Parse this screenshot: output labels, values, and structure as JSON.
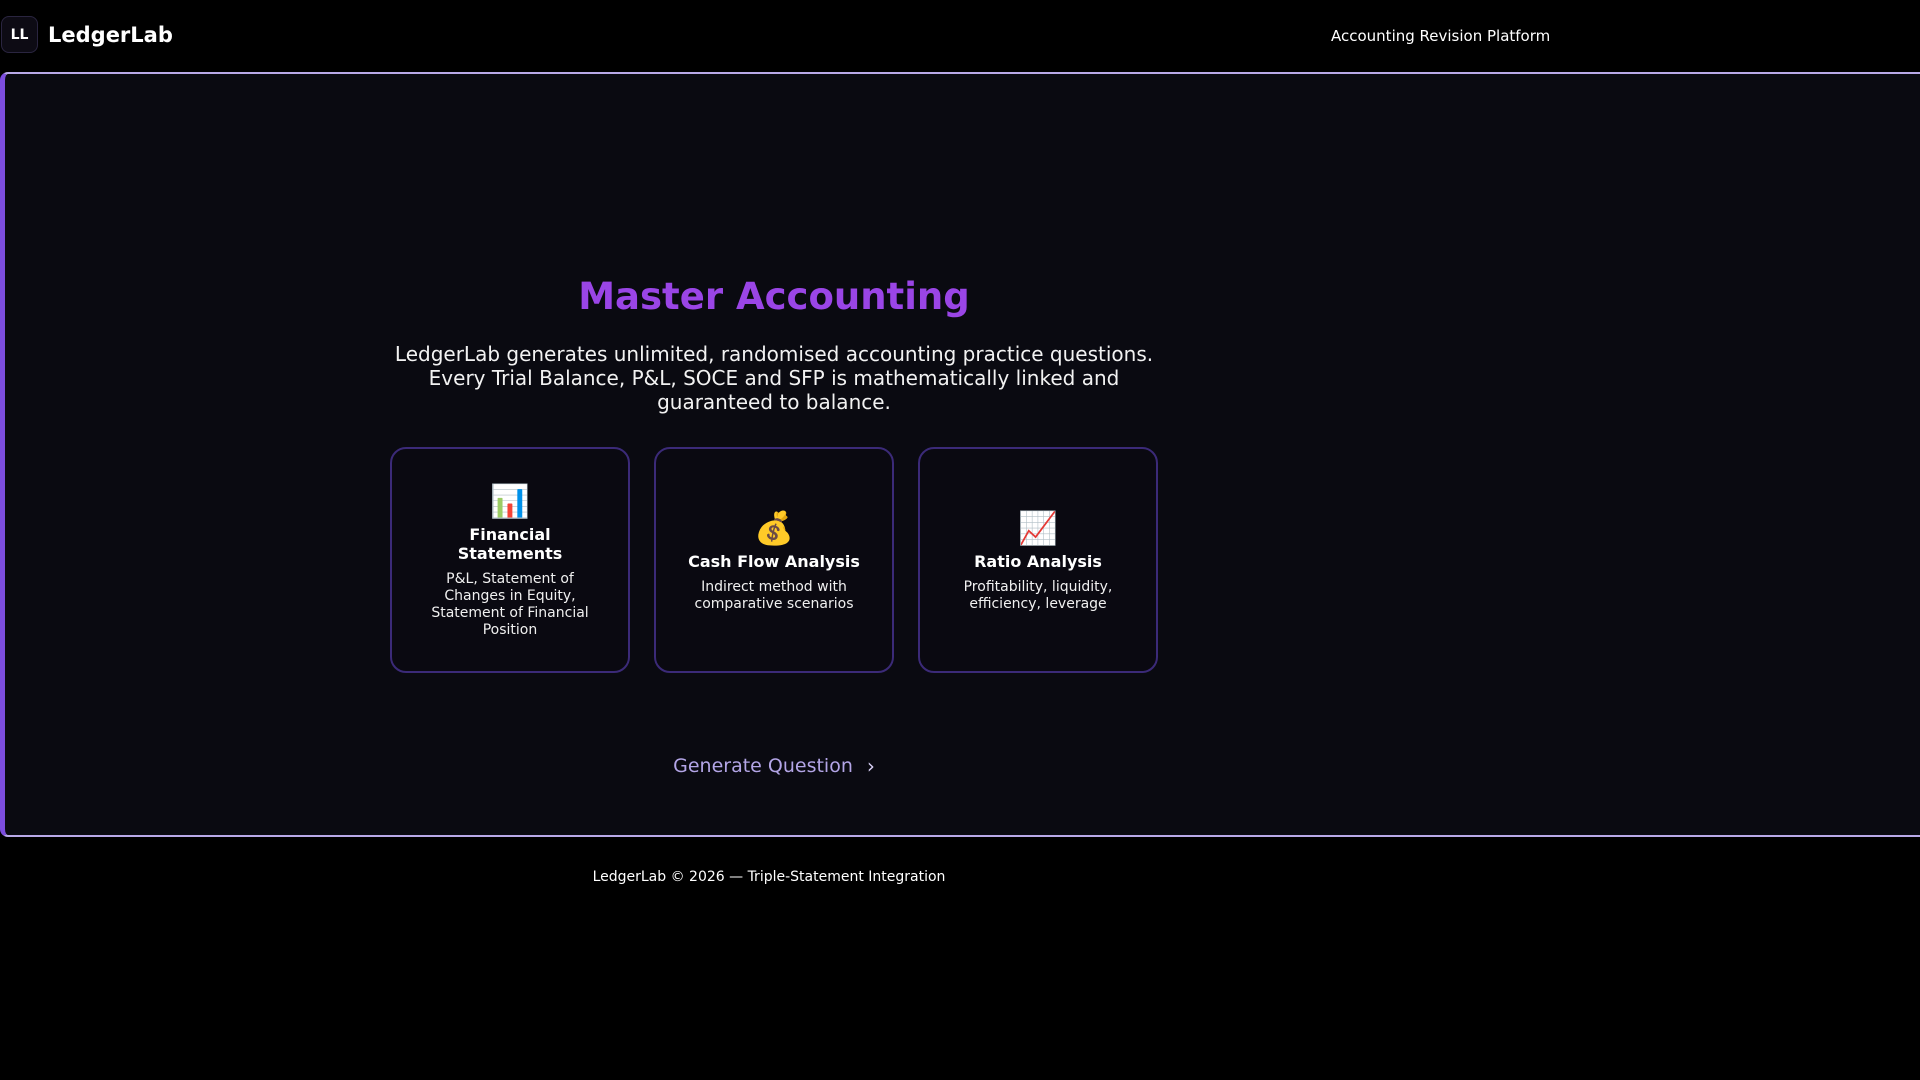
{
  "header": {
    "logo_initials": "LL",
    "brand": "LedgerLab",
    "tagline": "Accounting Revision Platform"
  },
  "hero": {
    "title": "Master Accounting",
    "description": "LedgerLab generates unlimited, randomised accounting practice questions. Every Trial Balance, P&L, SOCE and SFP is mathematically linked and guaranteed to balance."
  },
  "cards": [
    {
      "icon": "📊",
      "icon_name": "bar-chart-icon",
      "title": "Financial Statements",
      "text": "P&L, Statement of Changes in Equity, Statement of Financial Position"
    },
    {
      "icon": "💰",
      "icon_name": "money-bag-icon",
      "title": "Cash Flow Analysis",
      "text": "Indirect method with comparative scenarios"
    },
    {
      "icon": "📈",
      "icon_name": "trend-up-chart-icon",
      "title": "Ratio Analysis",
      "text": "Profitability, liquidity, efficiency, leverage"
    }
  ],
  "cta": {
    "label": "Generate Question",
    "chevron": "›"
  },
  "footer": {
    "text": "LedgerLab © 2026 — Triple-Statement Integration"
  },
  "colors": {
    "accent": "#9a45e6",
    "panel_border_left": "#7c4dde",
    "card_border": "#3b2a78",
    "cta_text": "#b3a5e6",
    "background": "#000000",
    "panel_background": "#0a0a11"
  }
}
